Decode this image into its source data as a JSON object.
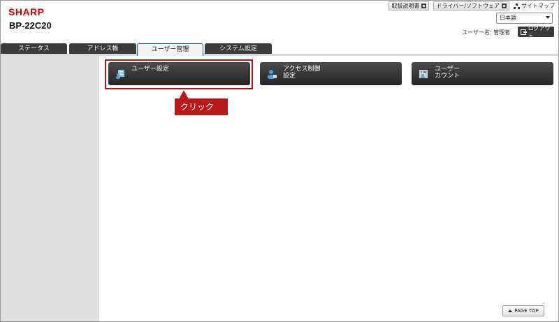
{
  "header": {
    "brand": "SHARP",
    "model": "BP-22C20",
    "manual_link": "取扱説明書",
    "driver_link": "ドライバー/ソフトウェア",
    "sitemap_link": "サイトマップ",
    "language": "日本語",
    "username_label": "ユーザー名: 管理者",
    "logout_label": "ログアウト"
  },
  "tabs": [
    {
      "label": "ステータス",
      "active": false
    },
    {
      "label": "アドレス帳",
      "active": false
    },
    {
      "label": "ユーザー管理",
      "active": true
    },
    {
      "label": "システム設定",
      "active": false
    }
  ],
  "menu": [
    {
      "line1": "ユーザー設定",
      "line2": "",
      "icon": "user-settings-icon"
    },
    {
      "line1": "アクセス制御",
      "line2": "設定",
      "icon": "access-control-icon"
    },
    {
      "line1": "ユーザー",
      "line2": "カウント",
      "icon": "user-count-icon"
    }
  ],
  "annotation": {
    "callout": "クリック",
    "color": "#b81818"
  },
  "footer": {
    "page_top": "PAGE TOP"
  }
}
